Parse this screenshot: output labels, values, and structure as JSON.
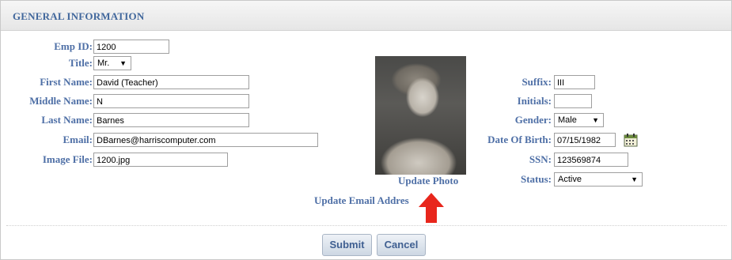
{
  "header": {
    "title": "GENERAL INFORMATION"
  },
  "left": {
    "emp_id": {
      "label": "Emp ID:",
      "value": "1200"
    },
    "title": {
      "label": "Title:",
      "value": "Mr."
    },
    "first_name": {
      "label": "First Name:",
      "value": "David (Teacher)"
    },
    "middle_name": {
      "label": "Middle Name:",
      "value": "N"
    },
    "last_name": {
      "label": "Last Name:",
      "value": "Barnes"
    },
    "email": {
      "label": "Email:",
      "value": "DBarnes@harriscomputer.com"
    },
    "image_file": {
      "label": "Image File:",
      "value": "1200.jpg"
    }
  },
  "right": {
    "suffix": {
      "label": "Suffix:",
      "value": "III"
    },
    "initials": {
      "label": "Initials:",
      "value": ""
    },
    "gender": {
      "label": "Gender:",
      "value": "Male"
    },
    "dob": {
      "label": "Date Of Birth:",
      "value": "07/15/1982"
    },
    "ssn": {
      "label": "SSN:",
      "value": "123569874"
    },
    "status": {
      "label": "Status:",
      "value": "Active"
    }
  },
  "links": {
    "update_photo": "Update Photo",
    "update_email": "Update Email Addres"
  },
  "buttons": {
    "submit": "Submit",
    "cancel": "Cancel"
  },
  "colors": {
    "label": "#4e6fa6",
    "header_text": "#41679c",
    "arrow": "#e8261c"
  },
  "icons": {
    "calendar": "calendar-icon",
    "red_arrow": "arrow-up-icon"
  }
}
